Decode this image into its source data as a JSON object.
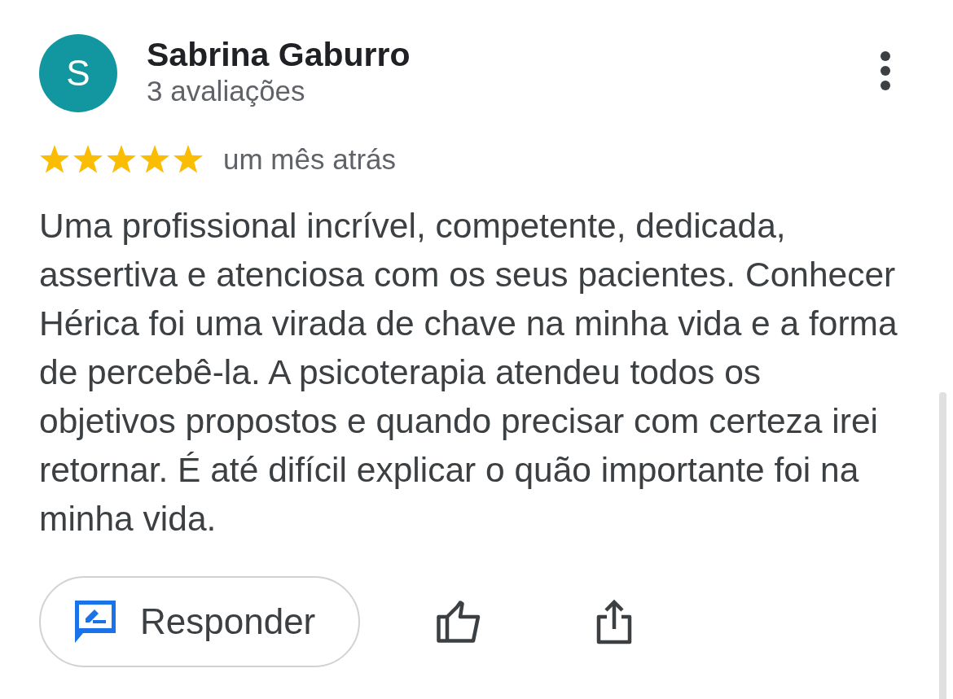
{
  "review": {
    "author": {
      "initial": "S",
      "name": "Sabrina Gaburro",
      "reviews": "3 avaliações"
    },
    "stars": 5,
    "time": "um mês atrás",
    "text": "Uma profissional incrível, competente, dedicada, assertiva e atenciosa com os seus pacientes. Conhecer Hérica foi uma virada de chave na minha vida e a forma de percebê-la. A psicoterapia atendeu todos os objetivos propostos e quando precisar com certeza irei retornar. É até difícil explicar o quão importante foi na minha vida."
  },
  "actions": {
    "reply": "Responder"
  }
}
